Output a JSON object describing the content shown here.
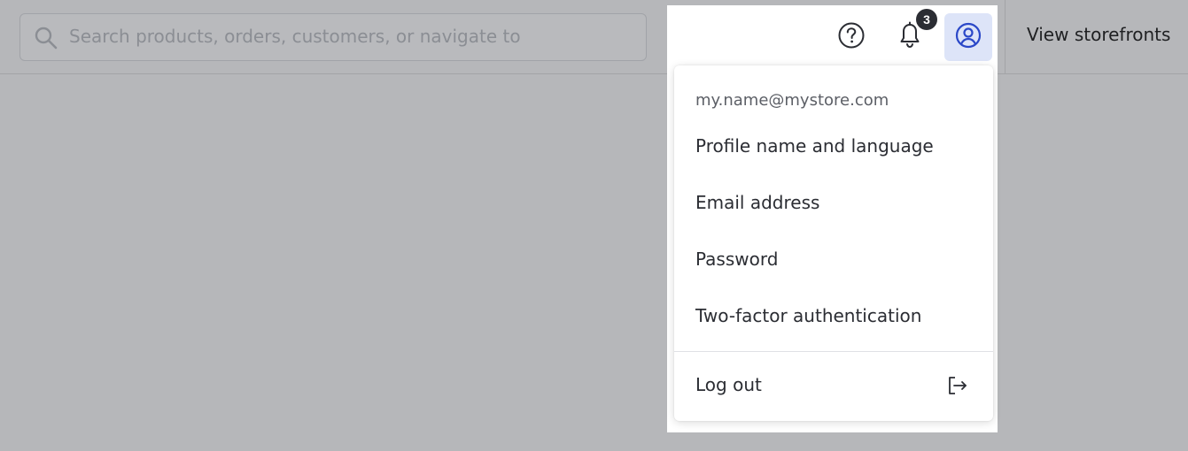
{
  "search": {
    "placeholder": "Search products, orders, customers, or navigate to",
    "icon": "search-icon"
  },
  "header": {
    "view_storefronts": "View storefronts",
    "help_icon": "help-circle-icon",
    "bell_icon": "bell-icon",
    "notification_count": "3",
    "profile_icon": "user-circle-icon"
  },
  "account_menu": {
    "email": "my.name@mystore.com",
    "items": [
      {
        "label": "Profile name and language"
      },
      {
        "label": "Email address"
      },
      {
        "label": "Password"
      },
      {
        "label": "Two-factor authentication"
      }
    ],
    "logout_label": "Log out",
    "logout_icon": "logout-icon"
  },
  "colors": {
    "overlay": "#b6b7ba",
    "profile_active_bg": "#dde4f8",
    "accent_blue": "#2b48c8",
    "text": "#2b2d33"
  }
}
